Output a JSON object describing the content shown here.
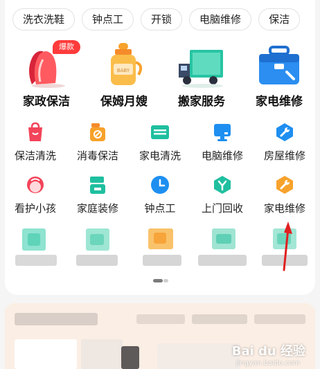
{
  "chips": [
    "洗衣洗鞋",
    "钟点工",
    "开锁",
    "电脑维修",
    "保洁"
  ],
  "featured": [
    {
      "label": "家政保洁",
      "icon": "cleaning-glove-icon",
      "badge": "爆款"
    },
    {
      "label": "保姆月嫂",
      "icon": "baby-bottle-icon"
    },
    {
      "label": "搬家服务",
      "icon": "moving-truck-icon"
    },
    {
      "label": "家电维修",
      "icon": "toolbox-icon"
    }
  ],
  "services_row1": [
    {
      "label": "保洁清洗",
      "icon": "cleaning-bag-icon",
      "color": "#f2445a"
    },
    {
      "label": "消毒保洁",
      "icon": "disinfect-spray-icon",
      "color": "#f7a22c"
    },
    {
      "label": "家电清洗",
      "icon": "appliance-icon",
      "color": "#1fbf9f"
    },
    {
      "label": "电脑维修",
      "icon": "monitor-icon",
      "color": "#1e8ff0"
    },
    {
      "label": "房屋维修",
      "icon": "wrench-icon",
      "color": "#1e8ff0"
    }
  ],
  "services_row2": [
    {
      "label": "看护小孩",
      "icon": "child-face-icon",
      "color": "#f2445a"
    },
    {
      "label": "家庭装修",
      "icon": "paint-roller-icon",
      "color": "#1fbf9f"
    },
    {
      "label": "钟点工",
      "icon": "clock-icon",
      "color": "#1e8ff0"
    },
    {
      "label": "上门回收",
      "icon": "recycle-icon",
      "color": "#1fbf9f"
    },
    {
      "label": "家电维修",
      "icon": "repair-wrench-icon",
      "color": "#f7a22c"
    }
  ],
  "watermark": {
    "brand": "Bai du 经验",
    "url": "jingyan.baidu.com"
  },
  "colors": {
    "accent_red": "#f2445a",
    "accent_orange": "#f7a22c",
    "accent_teal": "#1fbf9f",
    "accent_blue": "#1e8ff0",
    "arrow_red": "#e02020"
  }
}
